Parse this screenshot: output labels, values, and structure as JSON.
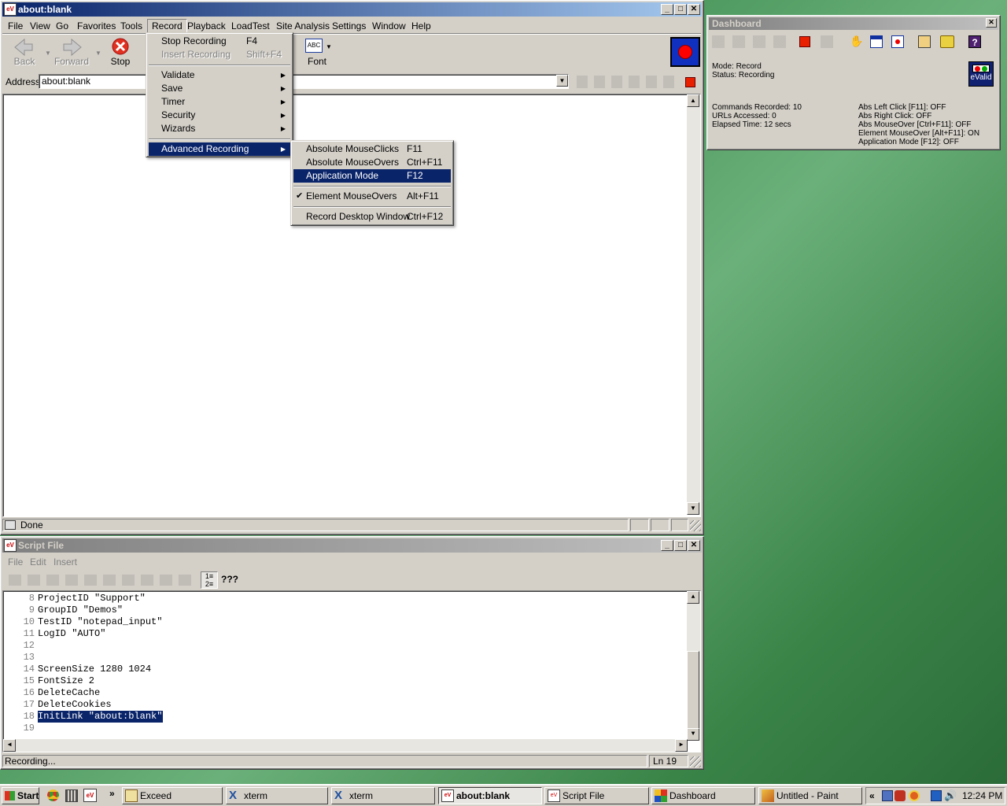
{
  "browser": {
    "title": "about:blank",
    "menu": [
      "File",
      "View",
      "Go",
      "Favorites",
      "Tools",
      "Record",
      "Playback",
      "LoadTest",
      "Site Analysis",
      "Settings",
      "Window",
      "Help"
    ],
    "toolbar": {
      "back": "Back",
      "forward": "Forward",
      "stop": "Stop",
      "font": "Font",
      "font_icon_text": "ABC"
    },
    "address_label": "Address",
    "address_value": "about:blank",
    "status": "Done"
  },
  "record_menu": {
    "items": [
      {
        "label": "Stop Recording",
        "shortcut": "F4"
      },
      {
        "label": "Insert Recording",
        "shortcut": "Shift+F4"
      },
      {
        "label": "Validate"
      },
      {
        "label": "Save"
      },
      {
        "label": "Timer"
      },
      {
        "label": "Security"
      },
      {
        "label": "Wizards"
      },
      {
        "label": "Advanced Recording"
      }
    ]
  },
  "adv_menu": {
    "items": [
      {
        "label": "Absolute MouseClicks",
        "shortcut": "F11"
      },
      {
        "label": "Absolute MouseOvers",
        "shortcut": "Ctrl+F11"
      },
      {
        "label": "Application Mode",
        "shortcut": "F12"
      },
      {
        "label": "Element MouseOvers",
        "shortcut": "Alt+F11"
      },
      {
        "label": "Record Desktop Window",
        "shortcut": "Ctrl+F12"
      }
    ]
  },
  "script": {
    "title": "Script File",
    "menu": [
      "File",
      "Edit",
      "Insert"
    ],
    "toolbar_text": "???",
    "lines": [
      {
        "n": "8",
        "t": "ProjectID \"Support\""
      },
      {
        "n": "9",
        "t": "GroupID \"Demos\""
      },
      {
        "n": "10",
        "t": "TestID \"notepad_input\""
      },
      {
        "n": "11",
        "t": "LogID \"AUTO\""
      },
      {
        "n": "12",
        "t": ""
      },
      {
        "n": "13",
        "t": ""
      },
      {
        "n": "14",
        "t": "ScreenSize 1280 1024"
      },
      {
        "n": "15",
        "t": "FontSize 2"
      },
      {
        "n": "16",
        "t": "DeleteCache"
      },
      {
        "n": "17",
        "t": "DeleteCookies"
      },
      {
        "n": "18",
        "t": "InitLink \"about:blank\""
      },
      {
        "n": "19",
        "t": ""
      }
    ],
    "status": "Recording...",
    "line_status": "Ln 19"
  },
  "dashboard": {
    "title": "Dashboard",
    "mode": "Mode: Record",
    "status": "Status: Recording",
    "commands": "Commands Recorded: 10",
    "urls": "URLs Accessed: 0",
    "elapsed": "Elapsed Time: 12 secs",
    "abs_left": "Abs Left Click [F11]: OFF",
    "abs_right": "Abs Right Click: OFF",
    "abs_mouseover": "Abs MouseOver [Ctrl+F11]: OFF",
    "element_mouseover": "Element MouseOver [Alt+F11]: ON",
    "app_mode": "Application Mode [F12]: OFF",
    "logo": "eValid"
  },
  "taskbar": {
    "start": "Start",
    "chevron": "»",
    "tasks": [
      "Exceed",
      "xterm",
      "xterm",
      "about:blank",
      "Script File",
      "Dashboard",
      "Untitled - Paint"
    ],
    "tray_chevron": "«",
    "clock": "12:24 PM"
  },
  "colors": {
    "titlebar": "#0a246a",
    "face": "#d4d0c8",
    "record_red": "#e02000"
  }
}
